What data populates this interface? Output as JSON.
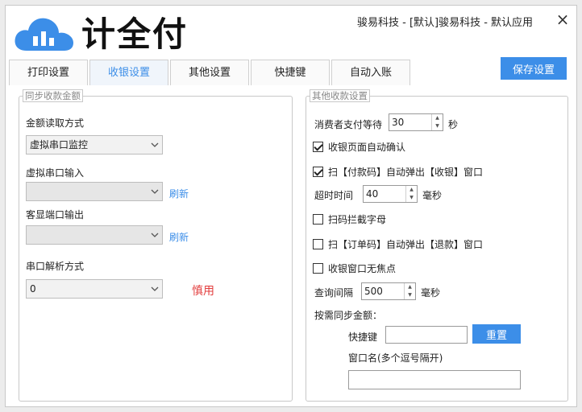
{
  "logo": {
    "text": "计全付"
  },
  "window": {
    "title": "骏易科技 - [默认]骏易科技 - 默认应用",
    "close_glyph": "×"
  },
  "toolbar": {
    "save_label": "保存设置"
  },
  "tabs": [
    {
      "label": "打印设置",
      "active": false
    },
    {
      "label": "收银设置",
      "active": true
    },
    {
      "label": "其他设置",
      "active": false
    },
    {
      "label": "快捷键",
      "active": false
    },
    {
      "label": "自动入账",
      "active": false
    }
  ],
  "left_panel": {
    "legend": "同步收款金额",
    "amount_read_label": "金额读取方式",
    "amount_read_value": "虚拟串口监控",
    "virtual_port_label": "虚拟串口输入",
    "virtual_port_value": "",
    "refresh1": "刷新",
    "display_port_label": "客显端口输出",
    "display_port_value": "",
    "refresh2": "刷新",
    "parse_label": "串口解析方式",
    "parse_value": "0",
    "caution": "慎用"
  },
  "right_panel": {
    "legend": "其他收款设置",
    "wait_label": "消费者支付等待",
    "wait_value": "30",
    "wait_unit": "秒",
    "auto_confirm": {
      "label": "收银页面自动确认",
      "checked": true
    },
    "scan_pay_popup": {
      "label": "扫【付款码】自动弹出【收银】窗口",
      "checked": true
    },
    "timeout_label": "超时时间",
    "timeout_value": "40",
    "timeout_unit": "毫秒",
    "intercept_letters": {
      "label": "扫码拦截字母",
      "checked": false
    },
    "scan_order_popup": {
      "label": "扫【订单码】自动弹出【退款】窗口",
      "checked": false
    },
    "no_focus": {
      "label": "收银窗口无焦点",
      "checked": false
    },
    "query_label": "查询间隔",
    "query_value": "500",
    "query_unit": "毫秒",
    "sync_label": "按需同步金额：",
    "hotkey_label": "快捷键",
    "hotkey_value": "",
    "reset_label": "重置",
    "window_name_label": "窗口名(多个逗号隔开)",
    "window_name_value": ""
  },
  "colors": {
    "accent": "#3c8ee8",
    "warn": "#e23c3c"
  },
  "icons": {
    "logo": "cloud-logo-icon",
    "dropdown": "chevron-down-icon",
    "close": "close-icon"
  }
}
